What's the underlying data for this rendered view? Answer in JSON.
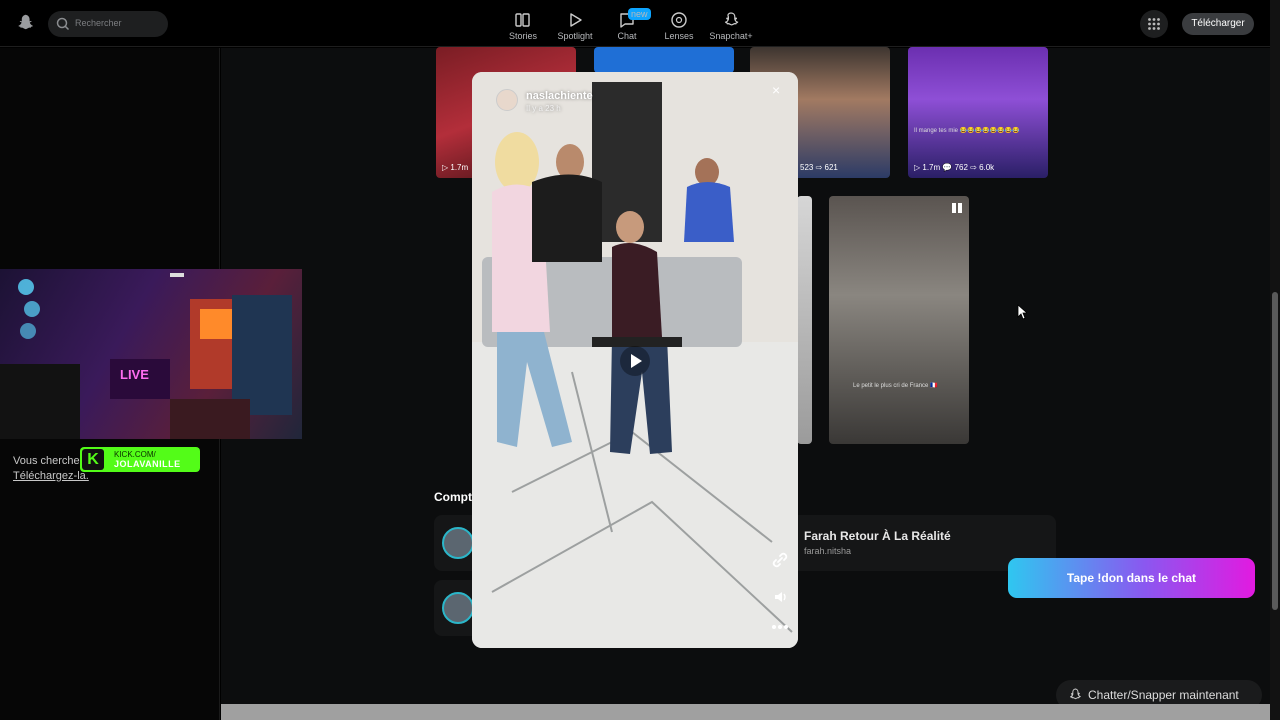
{
  "topbar": {
    "search_placeholder": "Rechercher",
    "nav": [
      {
        "label": "Stories",
        "icon": "stories-icon"
      },
      {
        "label": "Spotlight",
        "icon": "spotlight-icon"
      },
      {
        "label": "Chat",
        "icon": "chat-icon",
        "badge": "new"
      },
      {
        "label": "Lenses",
        "icon": "lenses-icon"
      },
      {
        "label": "Snapchat+",
        "icon": "snapchat-plus-icon"
      }
    ],
    "download_label": "Télécharger"
  },
  "left_panel": {
    "download_text": "Vous cherchez l'appli mobile&nbsp;?",
    "download_link": "Téléchargez-la."
  },
  "stream_overlay": {
    "kick_line1": "KICK.COM/",
    "kick_line2": "JOLAVANILLE"
  },
  "grid": {
    "tiles": [
      {
        "stats": "▷ 1.7m"
      },
      {
        "stats": "523 ⇨ 621"
      },
      {
        "caption": "Il mange tes mie 😂😂😂😂😂😂😂😂",
        "stats": "▷ 1.7m 💬 762 ⇨ 6.0k"
      },
      {
        "caption": "Le petit le plus cri de France 🇫🇷"
      }
    ]
  },
  "section": {
    "title": "Compt",
    "cards": [
      {
        "name": "Farah Retour À La Réalité",
        "handle": "farah.nitsha"
      }
    ]
  },
  "modal": {
    "username": "naslachiente",
    "time": "Il y a 23 h",
    "close": "×"
  },
  "don_button": "Tape !don dans le chat",
  "chatter_button": "Chatter/Snapper maintenant"
}
